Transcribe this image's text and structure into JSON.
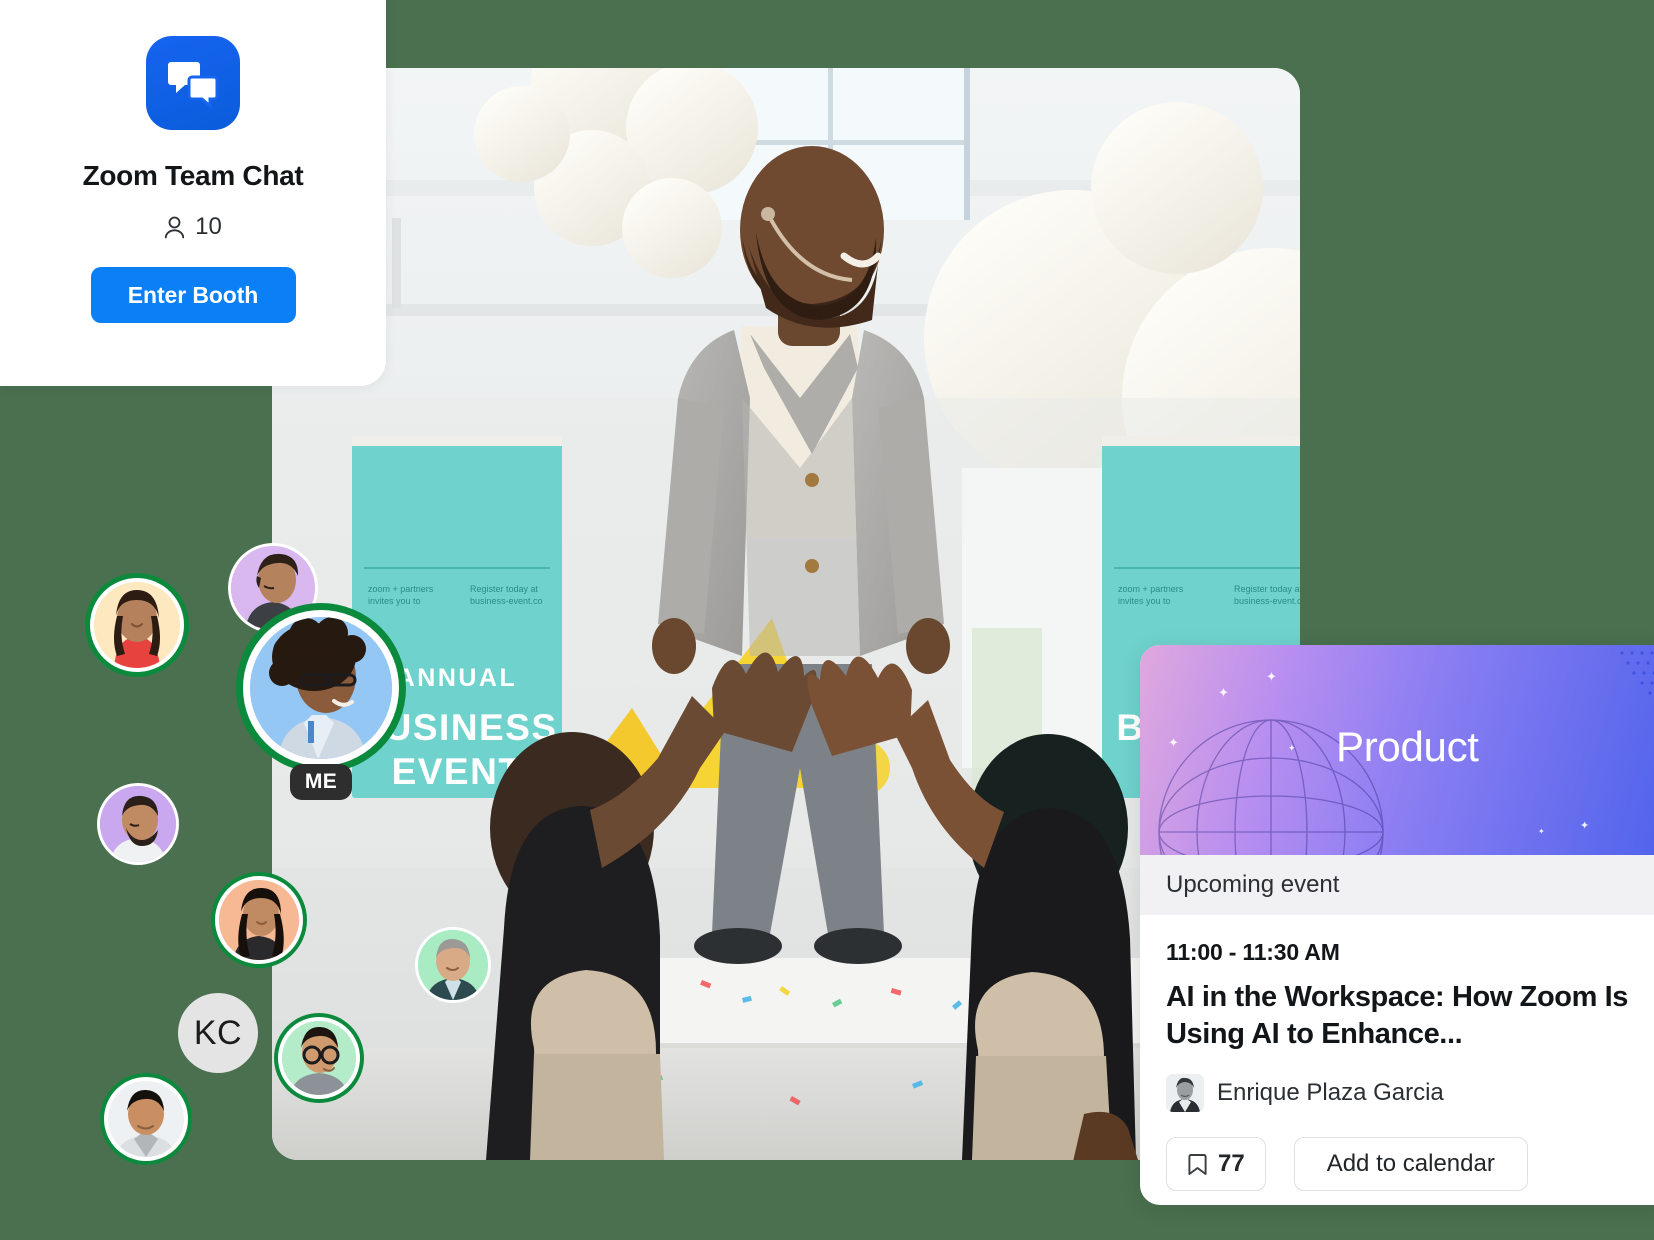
{
  "background": {
    "color": "#4a704f"
  },
  "booth": {
    "logo_icon": "chat-bubbles-icon",
    "title": "Zoom Team Chat",
    "attendee_icon": "person-icon",
    "attendee_count": "10",
    "cta_label": "Enter Booth",
    "cta_color": "#0b7ff5"
  },
  "stage_photo": {
    "alt": "Speaker on stage at an annual business event with audience applauding",
    "banner_text_line1": "ANNUAL",
    "banner_text_line2": "BUSINESS"
  },
  "participants": [
    {
      "name": "participant-1",
      "ring": "green",
      "bg": "#fde8c0",
      "label": ""
    },
    {
      "name": "participant-2",
      "ring": "none",
      "bg": "#d9b8f0",
      "label": ""
    },
    {
      "name": "participant-me",
      "ring": "green",
      "bg": "#95c7f5",
      "label": "ME"
    },
    {
      "name": "participant-3",
      "ring": "none",
      "bg": "#c9a8ef",
      "label": ""
    },
    {
      "name": "participant-4",
      "ring": "green",
      "bg": "#f7b894",
      "label": ""
    },
    {
      "name": "participant-5",
      "ring": "none",
      "bg": "#a9ecc4",
      "label": ""
    },
    {
      "name": "participant-kc",
      "ring": "none",
      "bg": "#e4e4e4",
      "label": "KC"
    },
    {
      "name": "participant-6",
      "ring": "green",
      "bg": "#b4ecc9",
      "label": ""
    },
    {
      "name": "participant-7",
      "ring": "green",
      "bg": "#eef1f3",
      "label": ""
    }
  ],
  "event_card": {
    "hero_category": "Product",
    "hero_gradient_from": "#e0a8de",
    "hero_gradient_to": "#4f63ec",
    "band_label": "Upcoming event",
    "time": "11:00 - 11:30 AM",
    "title": "AI in the Workspace: How Zoom Is Using AI to Enhance...",
    "speaker_name": "Enrique Plaza Garcia",
    "bookmark_icon": "bookmark-icon",
    "bookmark_count": "77",
    "calendar_label": "Add to calendar"
  }
}
